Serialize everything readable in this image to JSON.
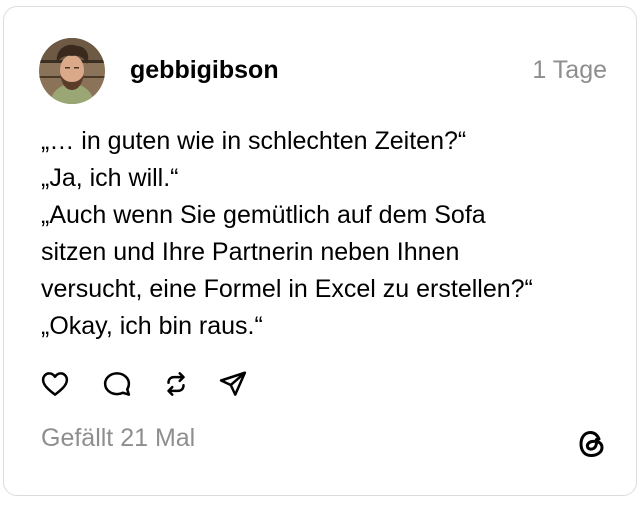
{
  "post": {
    "username": "gebbigibson",
    "timestamp": "1 Tage",
    "lines": [
      "„… in guten wie in schlechten Zeiten?“",
      "„Ja, ich will.“",
      "„Auch wenn Sie gemütlich auf dem Sofa",
      "sitzen und Ihre Partnerin neben Ihnen",
      "versucht, eine Formel in Excel zu erstellen?“",
      "„Okay, ich bin raus.“"
    ],
    "likes_text": "Gefällt 21 Mal"
  },
  "icons": {
    "avatar": "avatar-photo",
    "like": "heart-icon",
    "comment": "comment-bubble-icon",
    "repost": "repost-arrows-icon",
    "share": "send-paper-plane-icon",
    "brand": "threads-logo-icon"
  },
  "colors": {
    "text": "#000000",
    "muted": "#8e8e8e",
    "border": "#dcdcdc",
    "background": "#ffffff"
  }
}
